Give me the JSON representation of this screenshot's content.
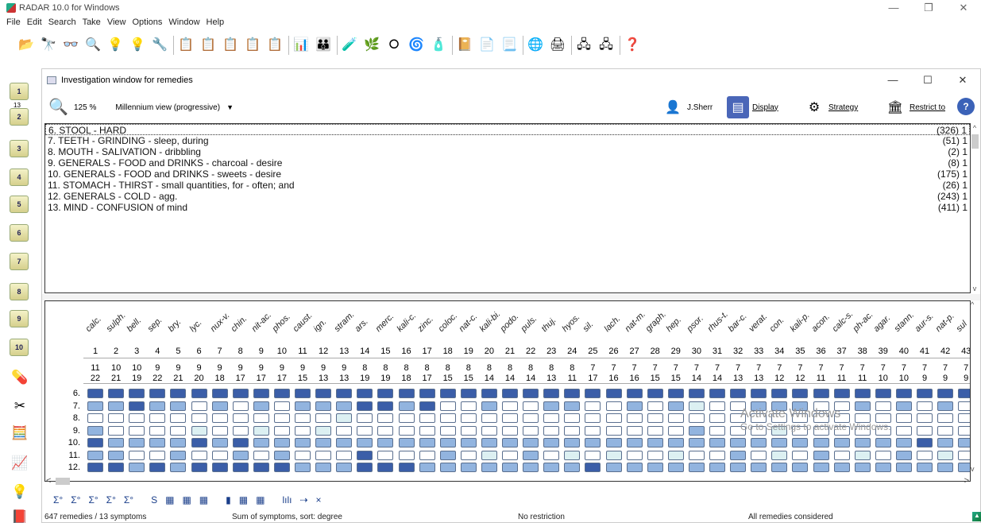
{
  "app": {
    "title": "RADAR 10.0 for Windows"
  },
  "menu": [
    "File",
    "Edit",
    "Search",
    "Take",
    "View",
    "Options",
    "Window",
    "Help"
  ],
  "left_tabs": [
    "1",
    "13",
    "2",
    "3",
    "4",
    "5",
    "6",
    "7",
    "8",
    "9",
    "10"
  ],
  "window": {
    "title": "Investigation window for remedies",
    "zoom": "125 %",
    "view_mode": "Millennium view (progressive)",
    "user": "J.Sherr",
    "display_label": "Display",
    "strategy_label": "Strategy",
    "restrict_label": "Restrict to"
  },
  "symptoms": [
    {
      "label": "6. STOOL - HARD",
      "count": "(326) 1"
    },
    {
      "label": "7. TEETH - GRINDING - sleep, during",
      "count": "(51) 1"
    },
    {
      "label": "8. MOUTH - SALIVATION - dribbling",
      "count": "(2) 1"
    },
    {
      "label": "9. GENERALS - FOOD and DRINKS - charcoal - desire",
      "count": "(8) 1"
    },
    {
      "label": "10. GENERALS - FOOD and DRINKS - sweets - desire",
      "count": "(175) 1"
    },
    {
      "label": "11. STOMACH - THIRST - small quantities, for - often; and",
      "count": "(26) 1"
    },
    {
      "label": "12. GENERALS - COLD - agg.",
      "count": "(243) 1"
    },
    {
      "label": "13. MIND - CONFUSION of mind",
      "count": "(411) 1"
    }
  ],
  "remedies": [
    {
      "name": "calc.",
      "num": "1",
      "s1": "11",
      "s2": "22"
    },
    {
      "name": "sulph.",
      "num": "2",
      "s1": "10",
      "s2": "21"
    },
    {
      "name": "bell.",
      "num": "3",
      "s1": "10",
      "s2": "19"
    },
    {
      "name": "sep.",
      "num": "4",
      "s1": "9",
      "s2": "22"
    },
    {
      "name": "bry.",
      "num": "5",
      "s1": "9",
      "s2": "21"
    },
    {
      "name": "lyc.",
      "num": "6",
      "s1": "9",
      "s2": "20"
    },
    {
      "name": "nux-v.",
      "num": "7",
      "s1": "9",
      "s2": "18"
    },
    {
      "name": "chin.",
      "num": "8",
      "s1": "9",
      "s2": "17"
    },
    {
      "name": "nit-ac.",
      "num": "9",
      "s1": "9",
      "s2": "17"
    },
    {
      "name": "phos.",
      "num": "10",
      "s1": "9",
      "s2": "17"
    },
    {
      "name": "caust.",
      "num": "11",
      "s1": "9",
      "s2": "15"
    },
    {
      "name": "ign.",
      "num": "12",
      "s1": "9",
      "s2": "13"
    },
    {
      "name": "stram.",
      "num": "13",
      "s1": "9",
      "s2": "13"
    },
    {
      "name": "ars.",
      "num": "14",
      "s1": "8",
      "s2": "19"
    },
    {
      "name": "merc.",
      "num": "15",
      "s1": "8",
      "s2": "19"
    },
    {
      "name": "kali-c.",
      "num": "16",
      "s1": "8",
      "s2": "18"
    },
    {
      "name": "zinc.",
      "num": "17",
      "s1": "8",
      "s2": "17"
    },
    {
      "name": "coloc.",
      "num": "18",
      "s1": "8",
      "s2": "15"
    },
    {
      "name": "nat-c.",
      "num": "19",
      "s1": "8",
      "s2": "15"
    },
    {
      "name": "kali-bi.",
      "num": "20",
      "s1": "8",
      "s2": "14"
    },
    {
      "name": "podo.",
      "num": "21",
      "s1": "8",
      "s2": "14"
    },
    {
      "name": "puls.",
      "num": "22",
      "s1": "8",
      "s2": "14"
    },
    {
      "name": "thuj.",
      "num": "23",
      "s1": "8",
      "s2": "13"
    },
    {
      "name": "hyos.",
      "num": "24",
      "s1": "8",
      "s2": "11"
    },
    {
      "name": "sil.",
      "num": "25",
      "s1": "7",
      "s2": "17"
    },
    {
      "name": "lach.",
      "num": "26",
      "s1": "7",
      "s2": "16"
    },
    {
      "name": "nat-m.",
      "num": "27",
      "s1": "7",
      "s2": "16"
    },
    {
      "name": "graph.",
      "num": "28",
      "s1": "7",
      "s2": "15"
    },
    {
      "name": "hep.",
      "num": "29",
      "s1": "7",
      "s2": "15"
    },
    {
      "name": "psor.",
      "num": "30",
      "s1": "7",
      "s2": "14"
    },
    {
      "name": "rhus-t.",
      "num": "31",
      "s1": "7",
      "s2": "14"
    },
    {
      "name": "bar-c.",
      "num": "32",
      "s1": "7",
      "s2": "13"
    },
    {
      "name": "verat.",
      "num": "33",
      "s1": "7",
      "s2": "13"
    },
    {
      "name": "con.",
      "num": "34",
      "s1": "7",
      "s2": "12"
    },
    {
      "name": "kali-p.",
      "num": "35",
      "s1": "7",
      "s2": "12"
    },
    {
      "name": "acon.",
      "num": "36",
      "s1": "7",
      "s2": "11"
    },
    {
      "name": "calc-s.",
      "num": "37",
      "s1": "7",
      "s2": "11"
    },
    {
      "name": "ph-ac.",
      "num": "38",
      "s1": "7",
      "s2": "11"
    },
    {
      "name": "agar.",
      "num": "39",
      "s1": "7",
      "s2": "10"
    },
    {
      "name": "stann.",
      "num": "40",
      "s1": "7",
      "s2": "10"
    },
    {
      "name": "aur-s.",
      "num": "41",
      "s1": "7",
      "s2": "9"
    },
    {
      "name": "nat-p.",
      "num": "42",
      "s1": "7",
      "s2": "9"
    },
    {
      "name": "sul",
      "num": "43",
      "s1": "7",
      "s2": "9"
    }
  ],
  "grid_rows": [
    {
      "label": "6.",
      "grades": [
        3,
        3,
        3,
        3,
        3,
        3,
        3,
        3,
        3,
        3,
        3,
        3,
        3,
        3,
        3,
        3,
        3,
        3,
        3,
        3,
        3,
        3,
        3,
        3,
        3,
        3,
        3,
        3,
        3,
        3,
        3,
        3,
        3,
        3,
        3,
        3,
        3,
        3,
        3,
        3,
        3,
        3,
        3
      ]
    },
    {
      "label": "7.",
      "grades": [
        2,
        2,
        3,
        2,
        2,
        0,
        2,
        0,
        2,
        0,
        2,
        2,
        2,
        3,
        3,
        2,
        3,
        0,
        0,
        2,
        0,
        0,
        2,
        2,
        0,
        0,
        2,
        0,
        2,
        1,
        0,
        0,
        2,
        2,
        2,
        0,
        0,
        2,
        0,
        2,
        0,
        2,
        0
      ]
    },
    {
      "label": "8.",
      "grades": [
        0,
        0,
        0,
        0,
        0,
        0,
        0,
        0,
        0,
        0,
        0,
        0,
        1,
        0,
        0,
        0,
        0,
        0,
        0,
        0,
        0,
        0,
        0,
        0,
        0,
        0,
        0,
        0,
        0,
        0,
        0,
        0,
        0,
        0,
        0,
        0,
        0,
        0,
        0,
        0,
        0,
        0,
        0
      ]
    },
    {
      "label": "9.",
      "grades": [
        2,
        0,
        0,
        0,
        0,
        1,
        0,
        0,
        1,
        0,
        0,
        1,
        0,
        0,
        0,
        0,
        0,
        0,
        0,
        0,
        0,
        0,
        0,
        0,
        0,
        0,
        0,
        0,
        0,
        2,
        0,
        0,
        0,
        1,
        0,
        0,
        0,
        0,
        0,
        0,
        0,
        0,
        0
      ]
    },
    {
      "label": "10.",
      "grades": [
        3,
        2,
        2,
        2,
        2,
        3,
        2,
        3,
        2,
        2,
        2,
        2,
        2,
        2,
        2,
        2,
        2,
        2,
        2,
        2,
        2,
        2,
        2,
        2,
        2,
        2,
        2,
        2,
        2,
        2,
        2,
        2,
        2,
        2,
        2,
        2,
        2,
        2,
        2,
        2,
        3,
        2,
        2
      ]
    },
    {
      "label": "11.",
      "grades": [
        2,
        2,
        0,
        0,
        2,
        0,
        0,
        2,
        0,
        2,
        0,
        0,
        0,
        3,
        0,
        0,
        0,
        2,
        0,
        1,
        0,
        2,
        0,
        1,
        0,
        1,
        0,
        0,
        1,
        0,
        0,
        2,
        0,
        1,
        0,
        2,
        0,
        1,
        0,
        2,
        0,
        1,
        0
      ]
    },
    {
      "label": "12.",
      "grades": [
        3,
        3,
        2,
        3,
        2,
        3,
        3,
        3,
        3,
        3,
        2,
        2,
        2,
        3,
        3,
        3,
        2,
        2,
        2,
        2,
        2,
        2,
        2,
        2,
        3,
        2,
        2,
        2,
        2,
        2,
        2,
        2,
        2,
        2,
        2,
        2,
        2,
        2,
        2,
        2,
        2,
        2,
        2
      ]
    }
  ],
  "bottom_tools": [
    "Σ°",
    "Σ°",
    "Σ°",
    "Σ°",
    "Σ°",
    "S",
    "▦",
    "▦",
    "▦",
    "▮",
    "▦",
    "▦",
    "lılı",
    "⇢",
    "×"
  ],
  "watermark": {
    "line1": "Activate Windows",
    "line2": "Go to Settings to activate Windows."
  },
  "status": {
    "remedies": "647 remedies / 13 symptoms",
    "sort": "Sum of symptoms, sort: degree",
    "restriction": "No restriction",
    "considered": "All remedies considered"
  }
}
